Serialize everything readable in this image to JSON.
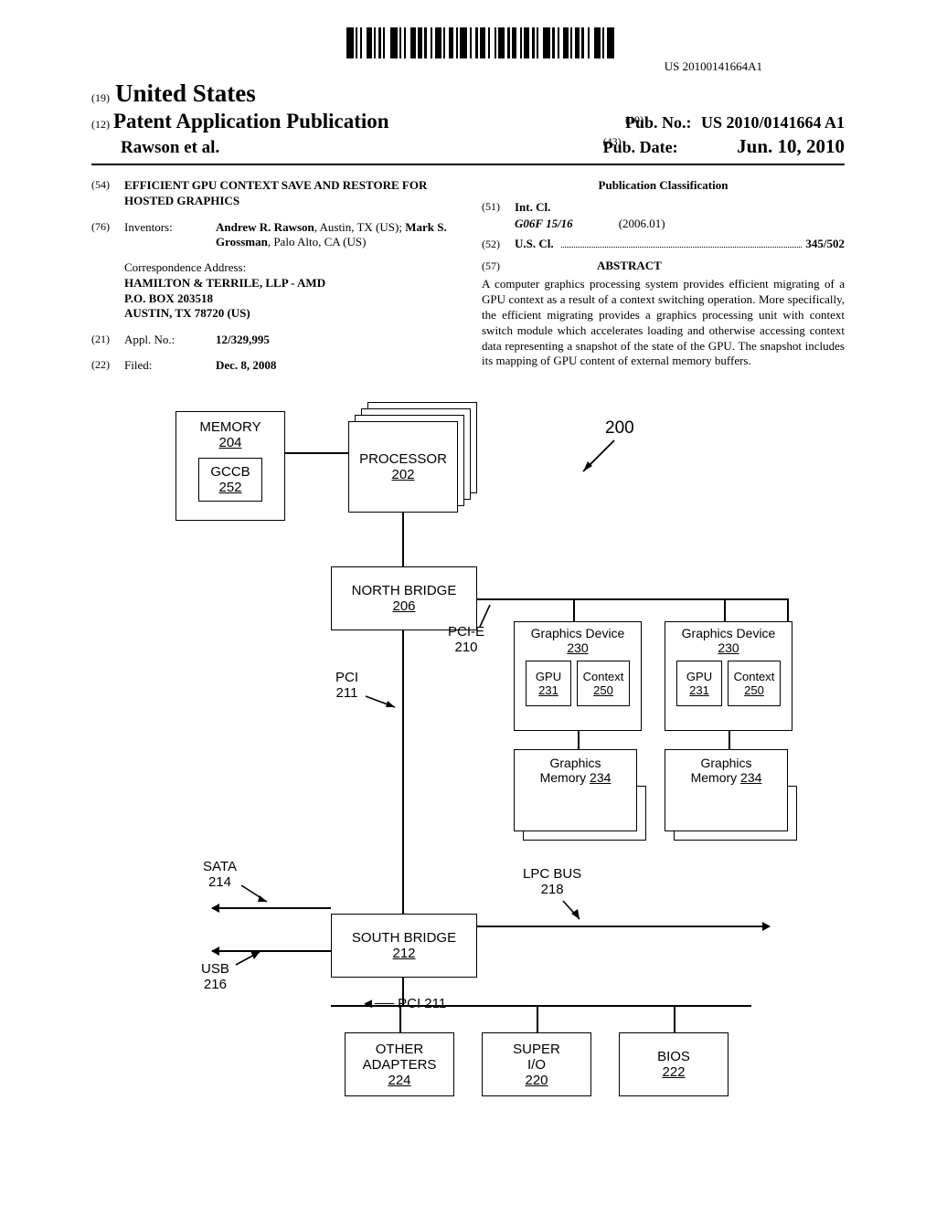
{
  "barcode_text": "US 20100141664A1",
  "code19": "(19)",
  "country": "United States",
  "code12": "(12)",
  "pub_type": "Patent Application Publication",
  "pubno_code": "(10)",
  "pubno_label": "Pub. No.:",
  "pubno_value": "US 2010/0141664 A1",
  "authors_line": "Rawson et al.",
  "pubdate_code": "(43)",
  "pubdate_label": "Pub. Date:",
  "pubdate_value": "Jun. 10, 2010",
  "f54_code": "(54)",
  "title": "EFFICIENT GPU CONTEXT SAVE AND RESTORE FOR HOSTED GRAPHICS",
  "f76_code": "(76)",
  "f76_label": "Inventors:",
  "inventors_html": "Andrew R. Rawson, Austin, TX (US); Mark S. Grossman, Palo Alto, CA (US)",
  "inventor1_name": "Andrew R. Rawson",
  "inventor1_loc": ", Austin, TX (US); ",
  "inventor2_name": "Mark S. Grossman",
  "inventor2_loc": ", Palo Alto, CA (US)",
  "corr_heading": "Correspondence Address:",
  "corr_l1": "HAMILTON & TERRILE, LLP - AMD",
  "corr_l2": "P.O. BOX 203518",
  "corr_l3": "AUSTIN, TX 78720 (US)",
  "f21_code": "(21)",
  "f21_label": "Appl. No.:",
  "appl_no": "12/329,995",
  "f22_code": "(22)",
  "f22_label": "Filed:",
  "filed_date": "Dec. 8, 2008",
  "class_heading": "Publication Classification",
  "f51_code": "(51)",
  "f51_label": "Int. Cl.",
  "intcl_class": "G06F 15/16",
  "intcl_date": "(2006.01)",
  "f52_code": "(52)",
  "f52_label": "U.S. Cl.",
  "uscl_value": "345/502",
  "f57_code": "(57)",
  "abstract_heading": "ABSTRACT",
  "abstract_body": "A computer graphics processing system provides efficient migrating of a GPU context as a result of a context switching operation. More specifically, the efficient migrating provides a graphics processing unit with context switch module which accelerates loading and otherwise accessing context data representing a snapshot of the state of the GPU. The snapshot includes its mapping of GPU content of external memory buffers.",
  "fig": {
    "memory": "MEMORY",
    "memory_ref": "204",
    "gccb": "GCCB",
    "gccb_ref": "252",
    "processor": "PROCESSOR",
    "processor_ref": "202",
    "ref200": "200",
    "northbridge": "NORTH BRIDGE",
    "northbridge_ref": "206",
    "pcie": "PCI-E",
    "pcie_ref": "210",
    "pci": "PCI",
    "pci_ref": "211",
    "gdev": "Graphics Device",
    "gdev_ref": "230",
    "gpu": "GPU",
    "gpu_ref": "231",
    "context": "Context",
    "context_ref": "250",
    "gmem": "Graphics",
    "gmem2": "Memory ",
    "gmem_ref": "234",
    "sata": "SATA",
    "sata_ref": "214",
    "usb": "USB",
    "usb_ref": "216",
    "southbridge": "SOUTH BRIDGE",
    "southbridge_ref": "212",
    "lpcbus": "LPC BUS",
    "lpcbus_ref": "218",
    "pci211": "PCI 211",
    "other": "OTHER",
    "adapters": "ADAPTERS",
    "other_ref": "224",
    "superio": "SUPER",
    "superio2": "I/O",
    "superio_ref": "220",
    "bios": "BIOS",
    "bios_ref": "222"
  }
}
